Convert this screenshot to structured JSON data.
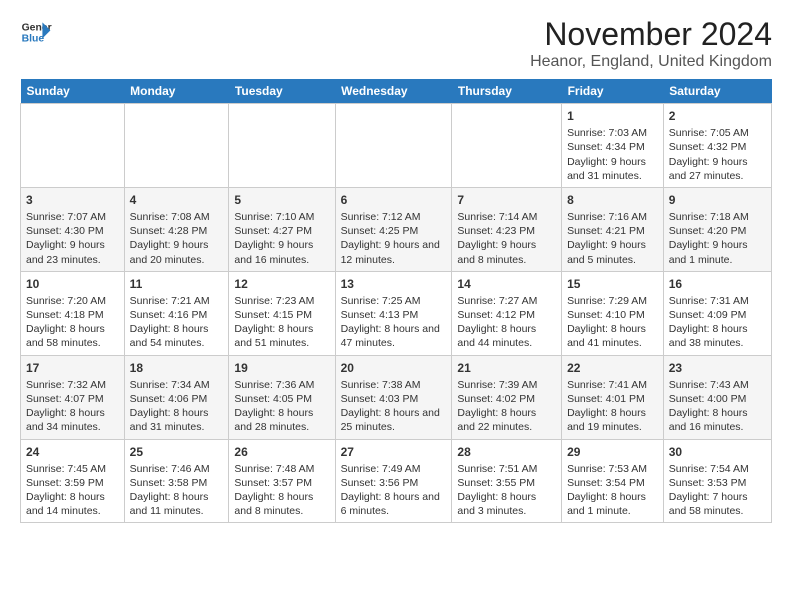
{
  "header": {
    "logo_line1": "General",
    "logo_line2": "Blue",
    "title": "November 2024",
    "subtitle": "Heanor, England, United Kingdom"
  },
  "weekdays": [
    "Sunday",
    "Monday",
    "Tuesday",
    "Wednesday",
    "Thursday",
    "Friday",
    "Saturday"
  ],
  "weeks": [
    [
      {
        "day": "",
        "info": ""
      },
      {
        "day": "",
        "info": ""
      },
      {
        "day": "",
        "info": ""
      },
      {
        "day": "",
        "info": ""
      },
      {
        "day": "",
        "info": ""
      },
      {
        "day": "1",
        "info": "Sunrise: 7:03 AM\nSunset: 4:34 PM\nDaylight: 9 hours and 31 minutes."
      },
      {
        "day": "2",
        "info": "Sunrise: 7:05 AM\nSunset: 4:32 PM\nDaylight: 9 hours and 27 minutes."
      }
    ],
    [
      {
        "day": "3",
        "info": "Sunrise: 7:07 AM\nSunset: 4:30 PM\nDaylight: 9 hours and 23 minutes."
      },
      {
        "day": "4",
        "info": "Sunrise: 7:08 AM\nSunset: 4:28 PM\nDaylight: 9 hours and 20 minutes."
      },
      {
        "day": "5",
        "info": "Sunrise: 7:10 AM\nSunset: 4:27 PM\nDaylight: 9 hours and 16 minutes."
      },
      {
        "day": "6",
        "info": "Sunrise: 7:12 AM\nSunset: 4:25 PM\nDaylight: 9 hours and 12 minutes."
      },
      {
        "day": "7",
        "info": "Sunrise: 7:14 AM\nSunset: 4:23 PM\nDaylight: 9 hours and 8 minutes."
      },
      {
        "day": "8",
        "info": "Sunrise: 7:16 AM\nSunset: 4:21 PM\nDaylight: 9 hours and 5 minutes."
      },
      {
        "day": "9",
        "info": "Sunrise: 7:18 AM\nSunset: 4:20 PM\nDaylight: 9 hours and 1 minute."
      }
    ],
    [
      {
        "day": "10",
        "info": "Sunrise: 7:20 AM\nSunset: 4:18 PM\nDaylight: 8 hours and 58 minutes."
      },
      {
        "day": "11",
        "info": "Sunrise: 7:21 AM\nSunset: 4:16 PM\nDaylight: 8 hours and 54 minutes."
      },
      {
        "day": "12",
        "info": "Sunrise: 7:23 AM\nSunset: 4:15 PM\nDaylight: 8 hours and 51 minutes."
      },
      {
        "day": "13",
        "info": "Sunrise: 7:25 AM\nSunset: 4:13 PM\nDaylight: 8 hours and 47 minutes."
      },
      {
        "day": "14",
        "info": "Sunrise: 7:27 AM\nSunset: 4:12 PM\nDaylight: 8 hours and 44 minutes."
      },
      {
        "day": "15",
        "info": "Sunrise: 7:29 AM\nSunset: 4:10 PM\nDaylight: 8 hours and 41 minutes."
      },
      {
        "day": "16",
        "info": "Sunrise: 7:31 AM\nSunset: 4:09 PM\nDaylight: 8 hours and 38 minutes."
      }
    ],
    [
      {
        "day": "17",
        "info": "Sunrise: 7:32 AM\nSunset: 4:07 PM\nDaylight: 8 hours and 34 minutes."
      },
      {
        "day": "18",
        "info": "Sunrise: 7:34 AM\nSunset: 4:06 PM\nDaylight: 8 hours and 31 minutes."
      },
      {
        "day": "19",
        "info": "Sunrise: 7:36 AM\nSunset: 4:05 PM\nDaylight: 8 hours and 28 minutes."
      },
      {
        "day": "20",
        "info": "Sunrise: 7:38 AM\nSunset: 4:03 PM\nDaylight: 8 hours and 25 minutes."
      },
      {
        "day": "21",
        "info": "Sunrise: 7:39 AM\nSunset: 4:02 PM\nDaylight: 8 hours and 22 minutes."
      },
      {
        "day": "22",
        "info": "Sunrise: 7:41 AM\nSunset: 4:01 PM\nDaylight: 8 hours and 19 minutes."
      },
      {
        "day": "23",
        "info": "Sunrise: 7:43 AM\nSunset: 4:00 PM\nDaylight: 8 hours and 16 minutes."
      }
    ],
    [
      {
        "day": "24",
        "info": "Sunrise: 7:45 AM\nSunset: 3:59 PM\nDaylight: 8 hours and 14 minutes."
      },
      {
        "day": "25",
        "info": "Sunrise: 7:46 AM\nSunset: 3:58 PM\nDaylight: 8 hours and 11 minutes."
      },
      {
        "day": "26",
        "info": "Sunrise: 7:48 AM\nSunset: 3:57 PM\nDaylight: 8 hours and 8 minutes."
      },
      {
        "day": "27",
        "info": "Sunrise: 7:49 AM\nSunset: 3:56 PM\nDaylight: 8 hours and 6 minutes."
      },
      {
        "day": "28",
        "info": "Sunrise: 7:51 AM\nSunset: 3:55 PM\nDaylight: 8 hours and 3 minutes."
      },
      {
        "day": "29",
        "info": "Sunrise: 7:53 AM\nSunset: 3:54 PM\nDaylight: 8 hours and 1 minute."
      },
      {
        "day": "30",
        "info": "Sunrise: 7:54 AM\nSunset: 3:53 PM\nDaylight: 7 hours and 58 minutes."
      }
    ]
  ]
}
